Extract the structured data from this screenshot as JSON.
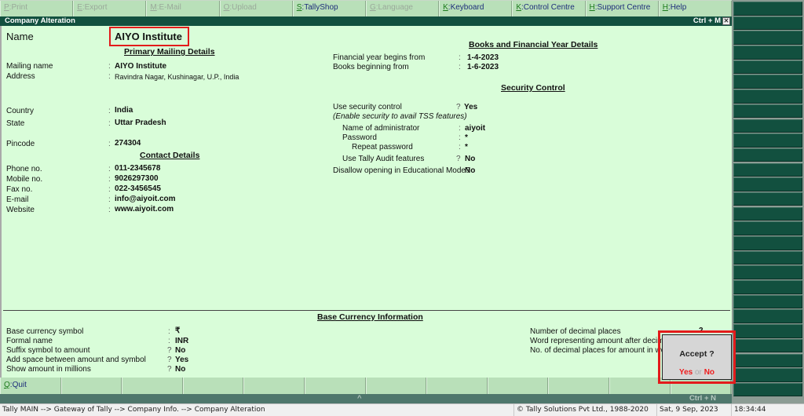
{
  "toolbar": {
    "buttons": [
      {
        "key": "P",
        "label": "Print",
        "enabled": false
      },
      {
        "key": "E",
        "label": "Export",
        "enabled": false
      },
      {
        "key": "M",
        "label": "E-Mail",
        "enabled": false
      },
      {
        "key": "O",
        "label": "Upload",
        "enabled": false
      },
      {
        "key": "S",
        "label": "TallyShop",
        "enabled": true
      },
      {
        "key": "G",
        "label": "Language",
        "enabled": false
      },
      {
        "key": "K",
        "label": "Keyboard",
        "enabled": true
      },
      {
        "key": "K",
        "label": "Control Centre",
        "enabled": true
      },
      {
        "key": "H",
        "label": "Support Centre",
        "enabled": true
      },
      {
        "key": "H",
        "label": "Help",
        "enabled": true
      }
    ]
  },
  "window": {
    "title": "Company  Alteration",
    "shortcut": "Ctrl + M",
    "close_glyph": "✕"
  },
  "form": {
    "name_label": "Name",
    "name_value": "AIYO Institute",
    "primary_heading": "Primary Mailing Details",
    "mailing_name_label": "Mailing name",
    "mailing_name_value": "AIYO Institute",
    "address_label": "Address",
    "address_value": "Ravindra Nagar, Kushinagar, U.P., India",
    "country_label": "Country",
    "country_value": "India",
    "state_label": "State",
    "state_value": "Uttar Pradesh",
    "pincode_label": "Pincode",
    "pincode_value": "274304",
    "contact_heading": "Contact Details",
    "phone_label": "Phone no.",
    "phone_value": "011-2345678",
    "mobile_label": "Mobile no.",
    "mobile_value": "9026297300",
    "fax_label": "Fax no.",
    "fax_value": "022-3456545",
    "email_label": "E-mail",
    "email_value": "info@aiyoit.com",
    "website_label": "Website",
    "website_value": "www.aiyoit.com",
    "colon": ":",
    "question": "?"
  },
  "books": {
    "heading": "Books and Financial Year Details",
    "fy_label": "Financial year begins from",
    "fy_value": "1-4-2023",
    "books_label": "Books beginning from",
    "books_value": "1-6-2023"
  },
  "security": {
    "heading": "Security Control",
    "use_label": "Use security control",
    "use_value": "Yes",
    "note": "(Enable security to avail TSS features)",
    "admin_label": "Name of administrator",
    "admin_value": "aiyoit",
    "password_label": "Password",
    "password_value": "*",
    "repeat_label": "Repeat password",
    "repeat_value": "*",
    "audit_label": "Use Tally Audit features",
    "audit_value": "No",
    "edu_label": "Disallow opening in Educational Mode?",
    "edu_value": "No"
  },
  "currency": {
    "heading": "Base Currency Information",
    "symbol_label": "Base currency symbol",
    "symbol_value": "₹",
    "formal_label": "Formal name",
    "formal_value": "INR",
    "suffix_label": "Suffix symbol to amount",
    "suffix_value": "No",
    "space_label": "Add space between amount and symbol",
    "space_value": "Yes",
    "millions_label": "Show amount in millions",
    "millions_value": "No",
    "decimals_label": "Number of decimal places",
    "decimals_value": "2",
    "word_label": "Word representing amount after decim",
    "words_dec_label": "No. of decimal places for amount in wo"
  },
  "dialog": {
    "question": "Accept ?",
    "yes": "Yes",
    "or": "or",
    "no": "No"
  },
  "bottom": {
    "quit_key": "Q",
    "quit_label": "Quit",
    "caret": "^",
    "shortcut": "Ctrl + N"
  },
  "status": {
    "breadcrumb": "Tally MAIN --> Gateway of Tally --> Company Info. --> Company  Alteration",
    "copyright": "© Tally Solutions Pvt Ltd., 1988-2020",
    "date": "Sat, 9 Sep, 2023",
    "time": "18:34:44"
  }
}
